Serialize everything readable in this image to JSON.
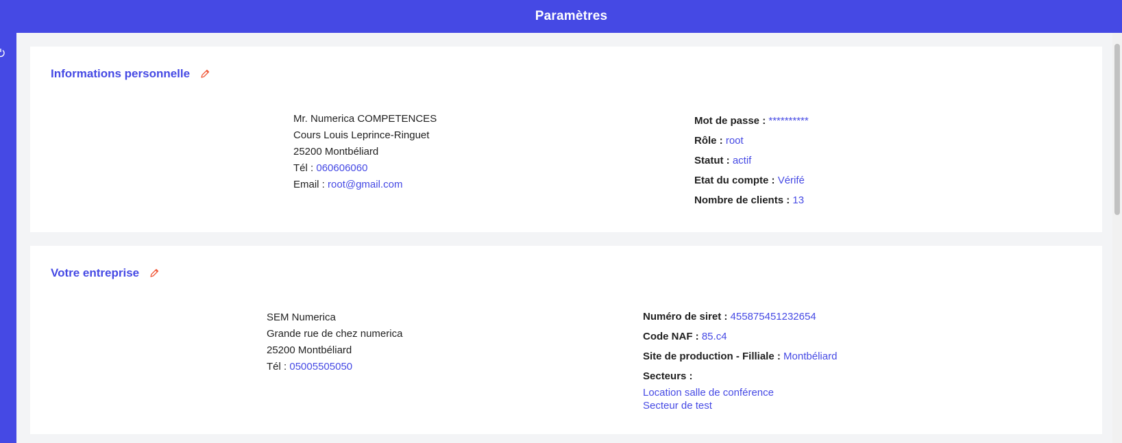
{
  "header": {
    "title": "Paramètres"
  },
  "personal": {
    "title": "Informations personnelle",
    "name": "Mr. Numerica COMPETENCES",
    "street": "Cours Louis Leprince-Ringuet",
    "city": "25200 Montbéliard",
    "tel_label": "Tél :",
    "tel": "060606060",
    "email_label": "Email :",
    "email": "root@gmail.com",
    "password_label": "Mot de passe :",
    "password": "**********",
    "role_label": "Rôle :",
    "role": "root",
    "status_label": "Statut :",
    "status": "actif",
    "account_label": "Etat du compte :",
    "account": "Vérifé",
    "clients_label": "Nombre de clients :",
    "clients": "13"
  },
  "company": {
    "title": "Votre entreprise",
    "name": "SEM Numerica",
    "street": "Grande rue de chez numerica",
    "city": "25200 Montbéliard",
    "tel_label": "Tél :",
    "tel": "05005505050",
    "siret_label": "Numéro de siret :",
    "siret": "455875451232654",
    "naf_label": "Code NAF :",
    "naf": "85.c4",
    "site_label": "Site de production - Filliale :",
    "site": "Montbéliard",
    "sectors_label": "Secteurs :",
    "sectors": [
      "Location salle de conférence",
      "Secteur de test"
    ]
  },
  "colors": {
    "accent": "#4549e4",
    "edit_icon": "#f05a3a",
    "background": "#f3f4f6"
  },
  "icons": {
    "edit": "pencil-icon",
    "sidebar": "power-icon"
  }
}
